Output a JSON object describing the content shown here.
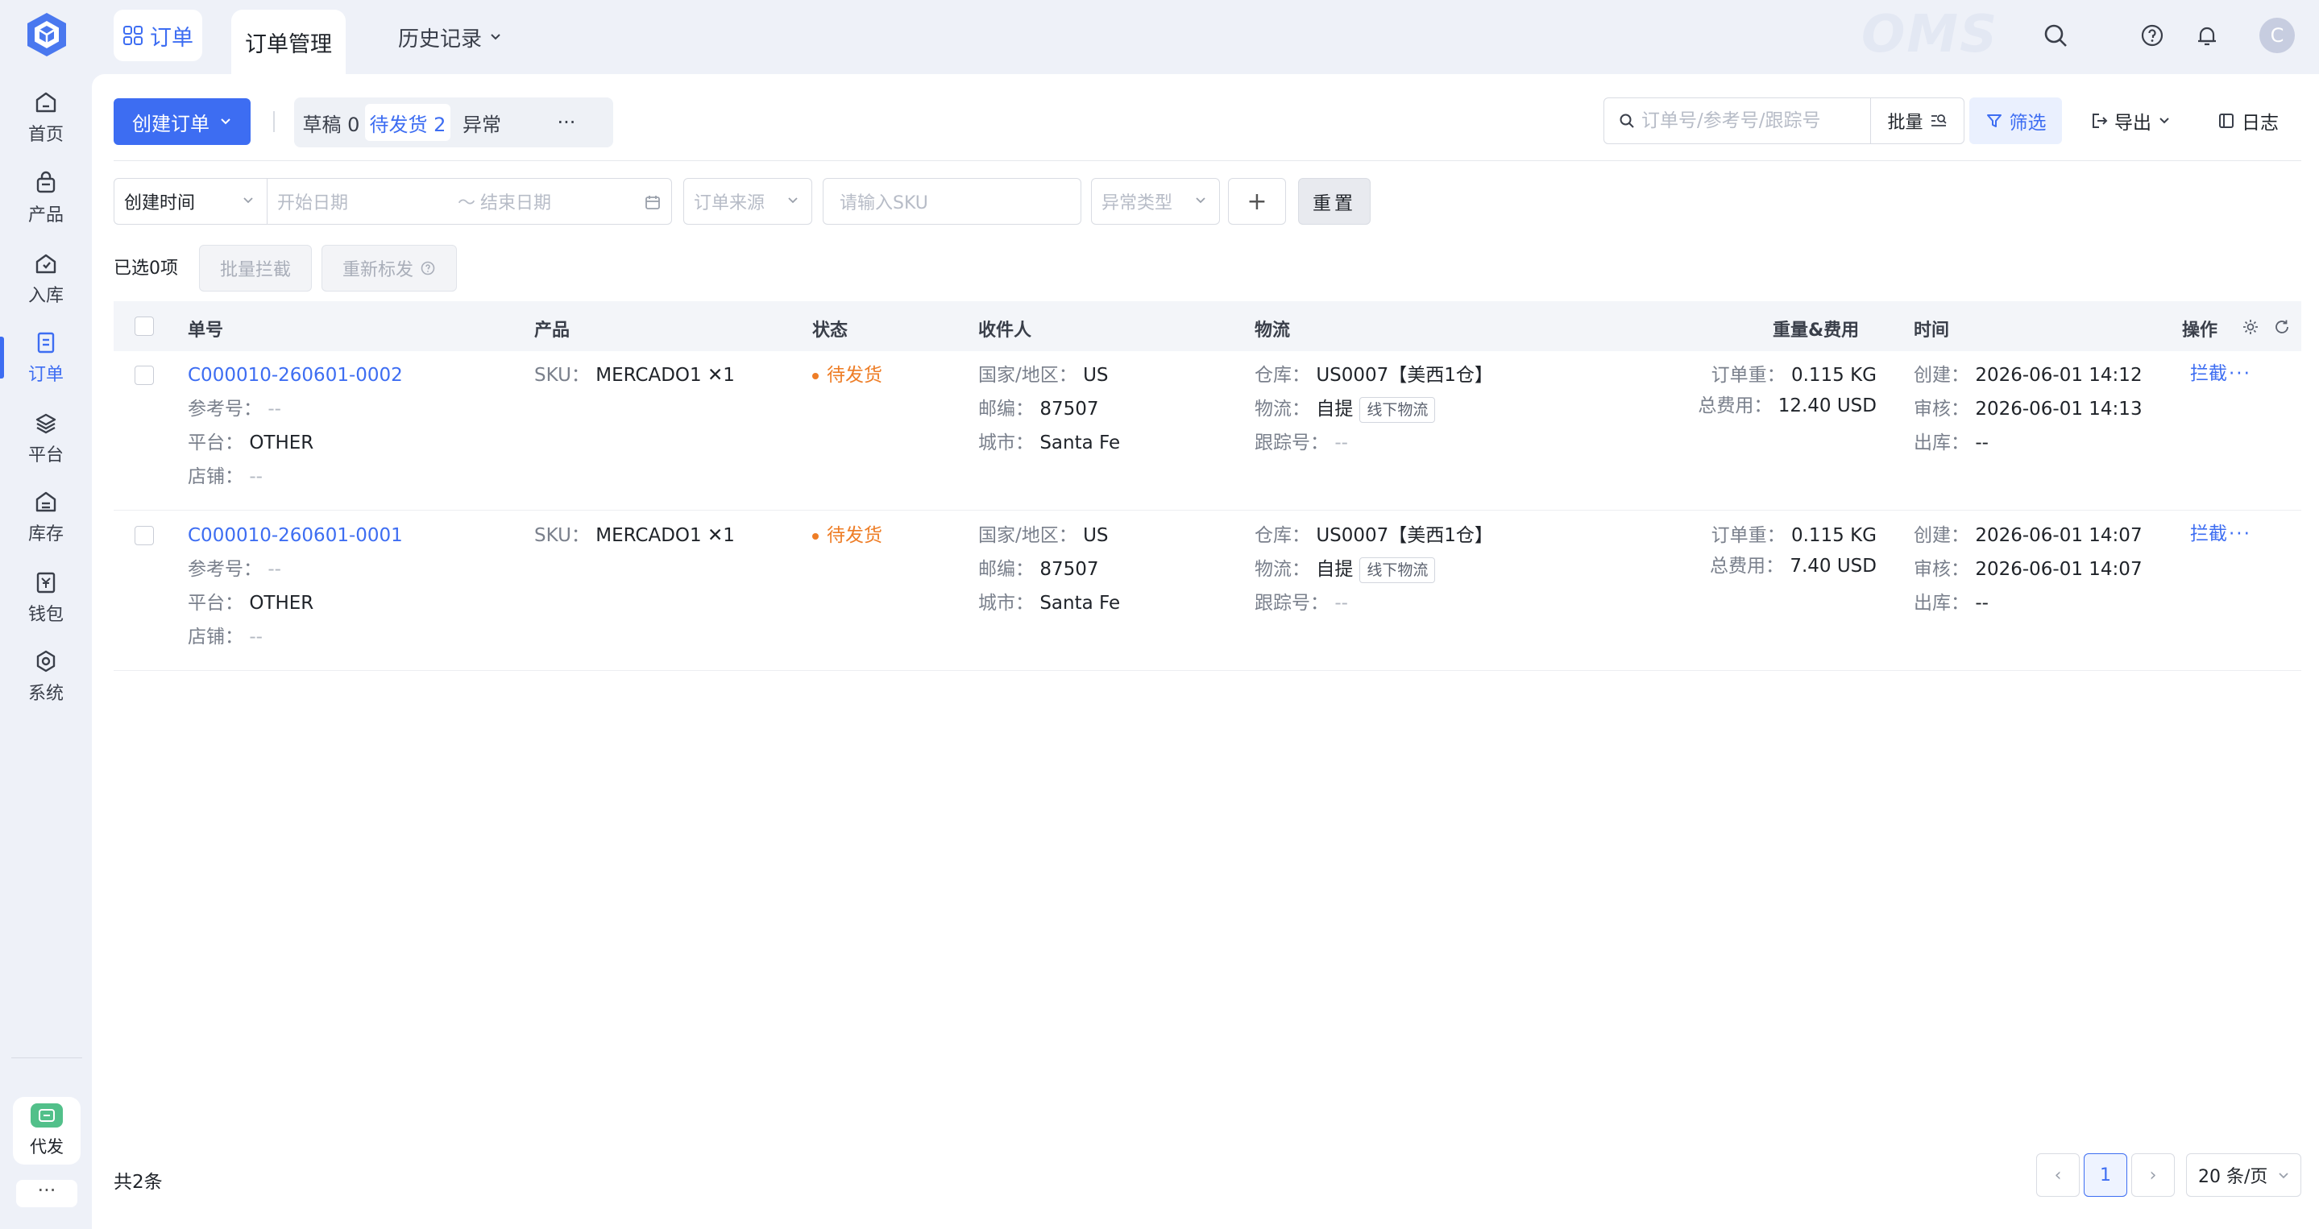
{
  "sidebar": {
    "items": [
      {
        "label": "首页",
        "icon": "home-icon"
      },
      {
        "label": "产品",
        "icon": "bag-icon"
      },
      {
        "label": "入库",
        "icon": "inbound-icon"
      },
      {
        "label": "订单",
        "icon": "order-icon",
        "active": true
      },
      {
        "label": "平台",
        "icon": "layers-icon"
      },
      {
        "label": "库存",
        "icon": "warehouse-icon"
      },
      {
        "label": "钱包",
        "icon": "wallet-icon"
      },
      {
        "label": "系统",
        "icon": "settings-icon"
      }
    ],
    "daifa_label": "代发",
    "more_label": "···"
  },
  "topbar": {
    "module_label": "订单",
    "active_tab": "订单管理",
    "history_tab": "历史记录",
    "watermark": "OMS",
    "avatar_initial": "C"
  },
  "toolbar": {
    "create_label": "创建订单",
    "status_tabs": [
      {
        "label": "草稿 0"
      },
      {
        "label": "待发货 2",
        "active": true
      },
      {
        "label": "异常"
      },
      {
        "label": "···"
      }
    ],
    "search_placeholder": "订单号/参考号/跟踪号",
    "batch_label": "批量",
    "filter_label": "筛选",
    "export_label": "导出",
    "log_label": "日志"
  },
  "filters": {
    "time_type": "创建时间",
    "start_placeholder": "开始日期",
    "range_sep": "～",
    "end_placeholder": "结束日期",
    "source_placeholder": "订单来源",
    "sku_placeholder": "请输入SKU",
    "exception_placeholder": "异常类型",
    "plus_label": "+",
    "reset_label": "重置"
  },
  "selection": {
    "selected_text": "已选0项",
    "batch_intercept": "批量拦截",
    "reship": "重新标发"
  },
  "table": {
    "headers": {
      "order_no": "单号",
      "product": "产品",
      "status": "状态",
      "recipient": "收件人",
      "logistics": "物流",
      "weight_fee": "重量&费用",
      "time": "时间",
      "action": "操作"
    },
    "labels": {
      "ref": "参考号：",
      "platform": "平台：",
      "shop": "店铺：",
      "sku": "SKU：",
      "country": "国家/地区：",
      "zip": "邮编：",
      "city": "城市：",
      "warehouse": "仓库：",
      "carrier": "物流：",
      "tracking": "跟踪号：",
      "weight": "订单重：",
      "fee": "总费用：",
      "created": "创建：",
      "audited": "审核：",
      "shipped": "出库："
    },
    "rows": [
      {
        "order_no": "C000010-260601-0002",
        "ref": "--",
        "platform": "OTHER",
        "shop": "--",
        "sku": "MERCADO1 ✕1",
        "status": "待发货",
        "country": "US",
        "zip": "87507",
        "city": "Santa Fe",
        "warehouse": "US0007【美西1仓】",
        "carrier": "自提",
        "carrier_tag": "线下物流",
        "tracking": "--",
        "weight": "0.115 KG",
        "fee": "12.40 USD",
        "created": "2026-06-01 14:12",
        "audited": "2026-06-01 14:13",
        "shipped": "--",
        "action": "拦截",
        "more": "···"
      },
      {
        "order_no": "C000010-260601-0001",
        "ref": "--",
        "platform": "OTHER",
        "shop": "--",
        "sku": "MERCADO1 ✕1",
        "status": "待发货",
        "country": "US",
        "zip": "87507",
        "city": "Santa Fe",
        "warehouse": "US0007【美西1仓】",
        "carrier": "自提",
        "carrier_tag": "线下物流",
        "tracking": "--",
        "weight": "0.115 KG",
        "fee": "7.40 USD",
        "created": "2026-06-01 14:07",
        "audited": "2026-06-01 14:07",
        "shipped": "--",
        "action": "拦截",
        "more": "···"
      }
    ]
  },
  "footer": {
    "total": "共2条",
    "current_page": "1",
    "prev": "‹",
    "next": "›",
    "page_size": "20 条/页"
  },
  "colors": {
    "accent": "#3d6df2",
    "status_pending": "#ee7d26",
    "daifa_badge": "#52c08a"
  }
}
